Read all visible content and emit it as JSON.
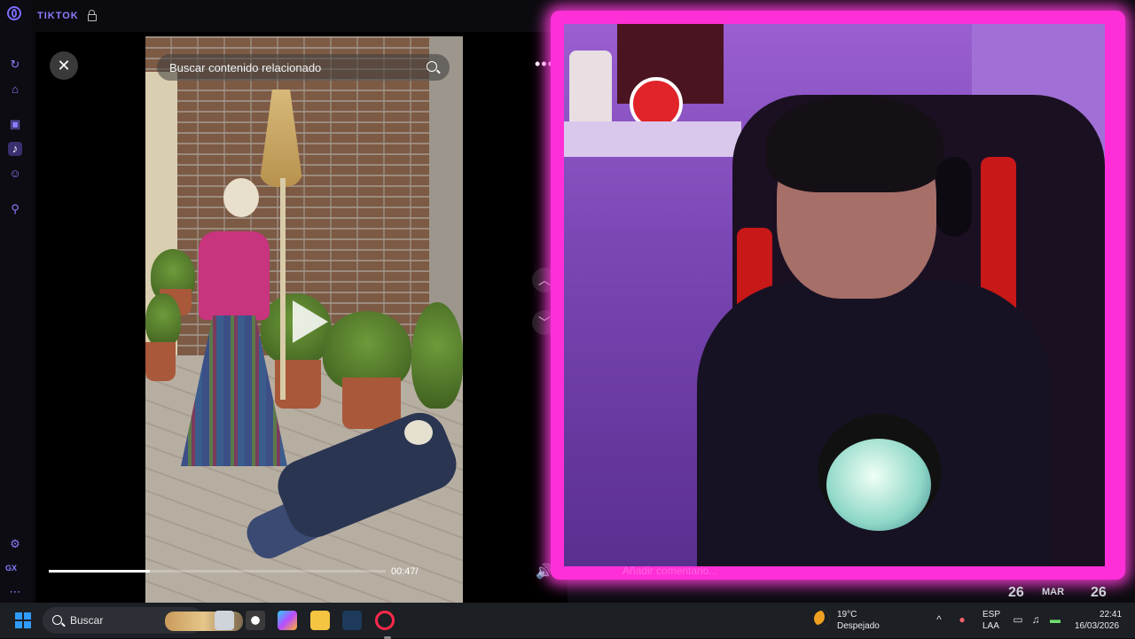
{
  "browser": {
    "tab_title": "TIKTOK",
    "sidebar_items": [
      {
        "name": "history"
      },
      {
        "name": "extensions"
      },
      {
        "name": "twitch"
      },
      {
        "name": "tiktok",
        "active": true
      },
      {
        "name": "discord"
      },
      {
        "name": "pin"
      }
    ],
    "sidebar_bottom_label": "GX"
  },
  "viewer": {
    "search_placeholder": "Buscar contenido relacionado",
    "time_current": "00:47/",
    "progress_fraction": 0.3,
    "comment_placeholder": "Añadir comentario..."
  },
  "overlay_ghost": {
    "date_left": "26",
    "month": "MAR",
    "date_right": "26"
  },
  "taskbar": {
    "search_label": "Buscar",
    "weather_temp": "19°C",
    "weather_desc": "Despejado",
    "lang_top": "ESP",
    "lang_bottom": "LAA",
    "time": "22:41",
    "date": "16/03/2026"
  },
  "colors": {
    "accent": "#8a7cff",
    "overlay_neon": "#ff2fd7",
    "taskbar": "#1c1f24"
  }
}
